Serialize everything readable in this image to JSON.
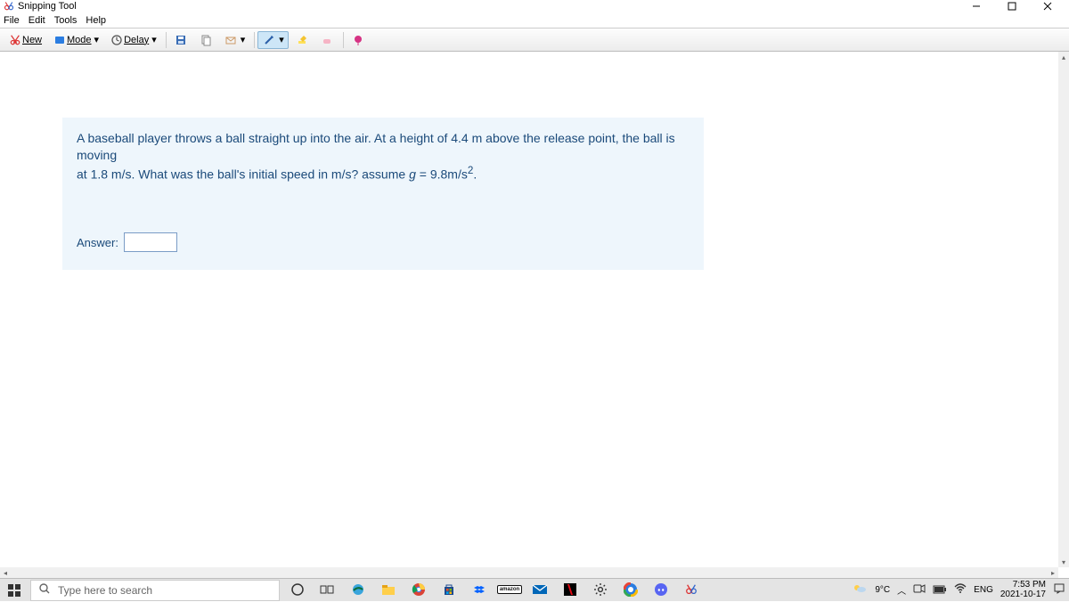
{
  "window": {
    "title": "Snipping Tool"
  },
  "menu": {
    "file": "File",
    "edit": "Edit",
    "tools": "Tools",
    "help": "Help"
  },
  "toolbar": {
    "new": "New",
    "mode": "Mode",
    "delay": "Delay"
  },
  "question": {
    "line1": "A baseball player throws a ball straight up into the air. At a height of 4.4 m above the release point, the ball is moving",
    "line2a": "at 1.8 m/s. What was the ball's initial speed in m/s? assume ",
    "g_var": "g",
    "eq": " = ",
    "g_val": "9.8m/s",
    "sq": "2",
    "period": ".",
    "answer_label": "Answer:"
  },
  "taskbar": {
    "search_placeholder": "Type here to search",
    "weather": "9°C",
    "lang": "ENG",
    "time": "7:53 PM",
    "date": "2021-10-17"
  }
}
